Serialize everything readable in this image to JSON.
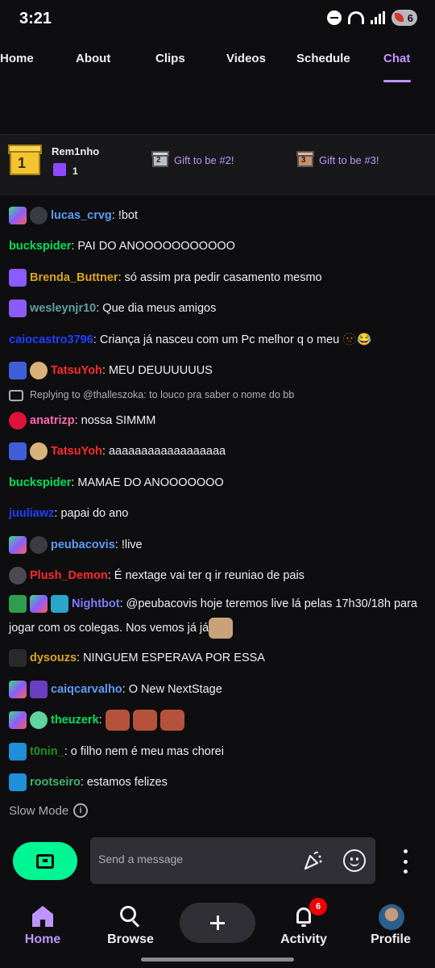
{
  "status_bar": {
    "time": "3:21",
    "battery": "6"
  },
  "tabs": [
    {
      "label": "Home"
    },
    {
      "label": "About"
    },
    {
      "label": "Clips"
    },
    {
      "label": "Videos"
    },
    {
      "label": "Schedule"
    },
    {
      "label": "Chat"
    }
  ],
  "gift_leaderboard": {
    "leader_name": "Rem1nho",
    "leader_rank": "1",
    "leader_count": "1",
    "slot2_rank": "2",
    "slot2_label": "Gift to be #2!",
    "slot3_rank": "3",
    "slot3_label": "Gift to be #3!"
  },
  "chat": {
    "messages": [
      {
        "user": "lucas_crvg",
        "text": ": !bot",
        "color": "#5b9cf6"
      },
      {
        "user": "buckspider",
        "text": ": PAI DO ANOOOOOOOOOOO",
        "color": "#00e05a"
      },
      {
        "user": "Brenda_Buttner",
        "text": ": só assim pra pedir casamento mesmo",
        "color": "#daa520"
      },
      {
        "user": "wesleynjr10",
        "text": ": Que dia meus amigos",
        "color": "#5f9ea0"
      },
      {
        "user": "caiocastro3796",
        "text": ": Criança já nasceu com um Pc melhor q o meu 🫥😂",
        "color": "#1e3fff"
      },
      {
        "user": "TatsuYoh",
        "text": ": MEU DEUUUUUUS",
        "color": "#ff2a2a"
      },
      {
        "user": "anatrizp",
        "text": ":  nossa SIMMM",
        "color": "#ff69b4"
      },
      {
        "user": "TatsuYoh",
        "text": ": aaaaaaaaaaaaaaaaaa",
        "color": "#ff2a2a"
      },
      {
        "user": "buckspider",
        "text": ": MAMAE DO ANOOOOOOO",
        "color": "#00e05a"
      },
      {
        "user": "juuliawz",
        "text": ": papai do ano",
        "color": "#1e3fff"
      },
      {
        "user": "peubacovis",
        "text": ": !live",
        "color": "#5b9cf6"
      },
      {
        "user": "Plush_Demon",
        "text": ": É nextage vai ter q ir reuniao de pais",
        "color": "#ff2a2a"
      },
      {
        "user": "Nightbot",
        "text": ": @peubacovis hoje teremos live lá pelas 17h30/18h para jogar com os colegas. Nos vemos já já",
        "color": "#7c7cff"
      },
      {
        "user": "dysouzs",
        "text": ": NINGUEM ESPERAVA POR ESSA",
        "color": "#daa520"
      },
      {
        "user": "caiqcarvalho",
        "text": ": O New NextStage",
        "color": "#5b9cf6"
      },
      {
        "user": "theuzerk",
        "text": ":",
        "color": "#00e05a"
      },
      {
        "user": "t0nin_",
        "text": ": o filho nem é meu mas chorei",
        "color": "#1f8f1f"
      },
      {
        "user": "rootseiro",
        "text": ": estamos felizes",
        "color": "#3cb371"
      }
    ],
    "reply_context": "Replying to @thalleszoka: to louco pra saber o nome do bb",
    "slow_mode": "Slow Mode"
  },
  "input": {
    "placeholder": "Send a message"
  },
  "bottom_nav": {
    "home": "Home",
    "browse": "Browse",
    "activity": "Activity",
    "activity_count": "6",
    "profile": "Profile"
  }
}
